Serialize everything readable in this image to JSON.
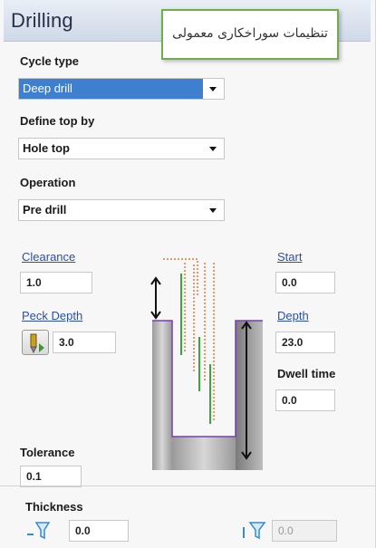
{
  "title": "Drilling",
  "callout": "تنظیمات سوراخکاری معمولی",
  "cycle_type": {
    "label": "Cycle type",
    "value": "Deep drill"
  },
  "define_top_by": {
    "label": "Define top by",
    "value": "Hole top"
  },
  "operation": {
    "label": "Operation",
    "value": "Pre drill"
  },
  "clearance": {
    "label": "Clearance",
    "value": "1.0"
  },
  "peck_depth": {
    "label": "Peck Depth",
    "value": "3.0"
  },
  "start": {
    "label": "Start",
    "value": "0.0"
  },
  "depth": {
    "label": "Depth",
    "value": "23.0"
  },
  "dwell_time": {
    "label": "Dwell time",
    "value": "0.0"
  },
  "tolerance": {
    "label": "Tolerance",
    "value": "0.1"
  },
  "thickness": {
    "label": "Thickness",
    "left_value": "0.0",
    "right_value": "0.0"
  },
  "colors": {
    "title_bg": "#cfd9e8",
    "selection": "#3f7fcf",
    "callout_border": "#6fae4a",
    "link": "#2a4fb0"
  },
  "icons": [
    "chevron-down-icon",
    "drill-tool-icon",
    "thickness-filter-icon"
  ]
}
